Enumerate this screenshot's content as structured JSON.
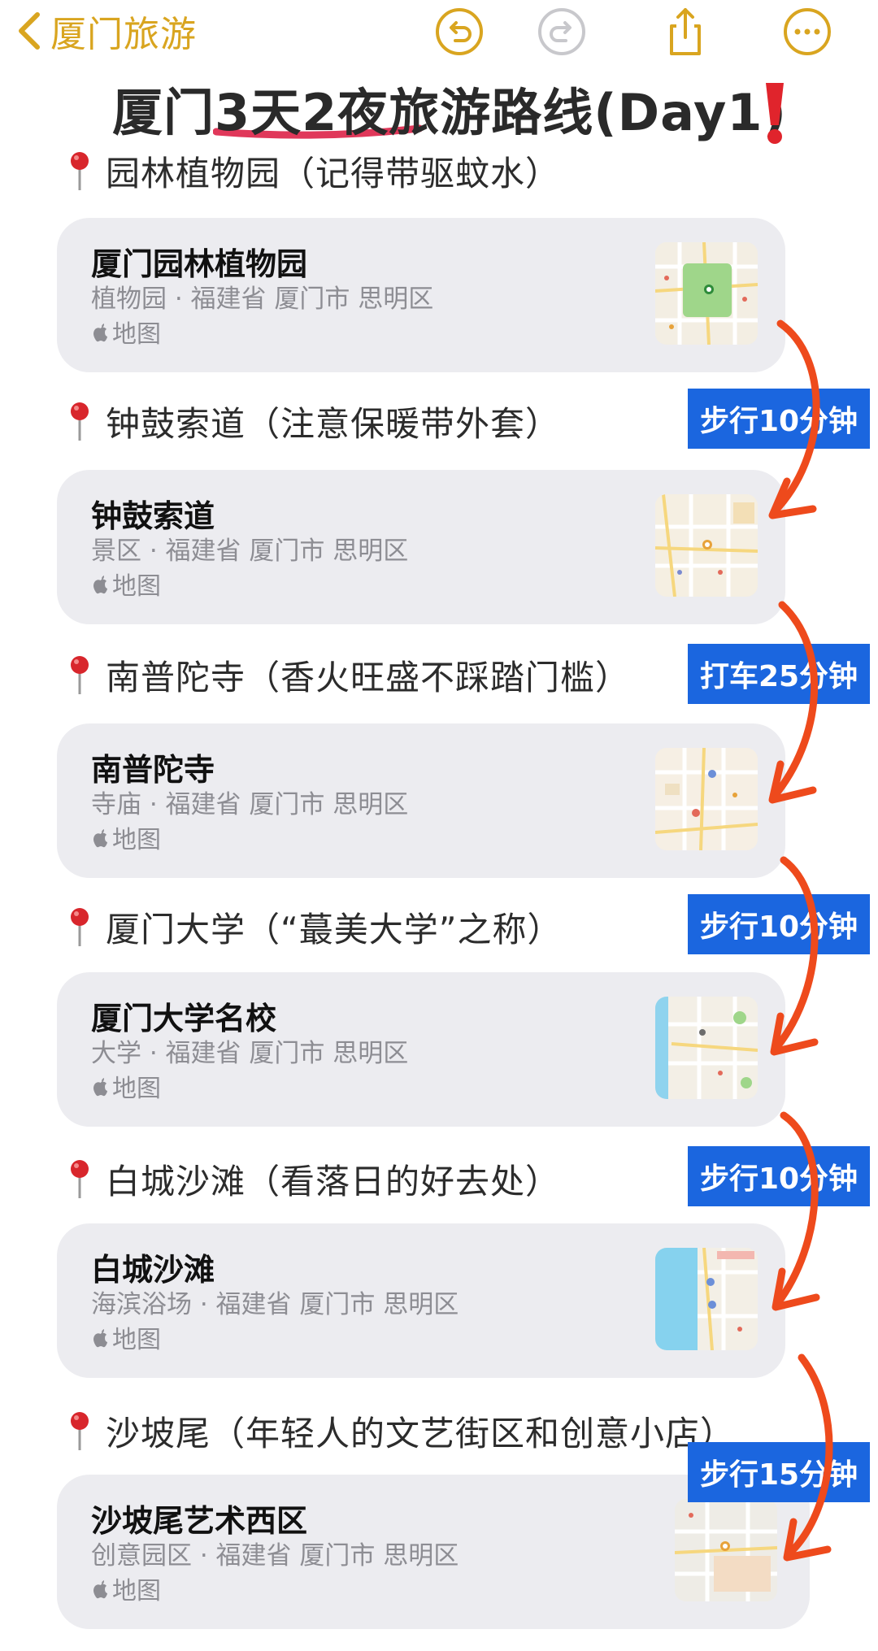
{
  "header": {
    "back_label": "厦门旅游"
  },
  "title": {
    "text": "厦门3天2夜旅游路线(Day1)"
  },
  "sections": [
    {
      "heading": "园林植物园（记得带驱蚊水）",
      "card": {
        "name": "厦门园林植物园",
        "meta": "植物园 · 福建省 厦门市 思明区",
        "source": "地图"
      }
    },
    {
      "heading": "钟鼓索道（注意保暖带外套）",
      "card": {
        "name": "钟鼓索道",
        "meta": "景区 · 福建省 厦门市 思明区",
        "source": "地图"
      }
    },
    {
      "heading": "南普陀寺（香火旺盛不踩踏门槛）",
      "card": {
        "name": "南普陀寺",
        "meta": "寺庙 · 福建省 厦门市 思明区",
        "source": "地图"
      }
    },
    {
      "heading": "厦门大学（“蕞美大学”之称）",
      "card": {
        "name": "厦门大学名校",
        "meta": "大学 · 福建省 厦门市 思明区",
        "source": "地图"
      }
    },
    {
      "heading": "白城沙滩（看落日的好去处）",
      "card": {
        "name": "白城沙滩",
        "meta": "海滨浴场 · 福建省 厦门市 思明区",
        "source": "地图"
      }
    },
    {
      "heading": "沙坡尾（年轻人的文艺街区和创意小店）",
      "card": {
        "name": "沙坡尾艺术西区",
        "meta": "创意园区 · 福建省 厦门市 思明区",
        "source": "地图"
      }
    }
  ],
  "travel": [
    {
      "label": "步行10分钟"
    },
    {
      "label": "打车25分钟"
    },
    {
      "label": "步行10分钟"
    },
    {
      "label": "步行10分钟"
    },
    {
      "label": "步行15分钟"
    }
  ],
  "colors": {
    "accent": "#d9a520",
    "card_bg": "#ececf0",
    "travel_bg": "#1b66df",
    "arrow": "#ee4a1c",
    "underline": "#e0385a",
    "pin": "#d8262c"
  }
}
